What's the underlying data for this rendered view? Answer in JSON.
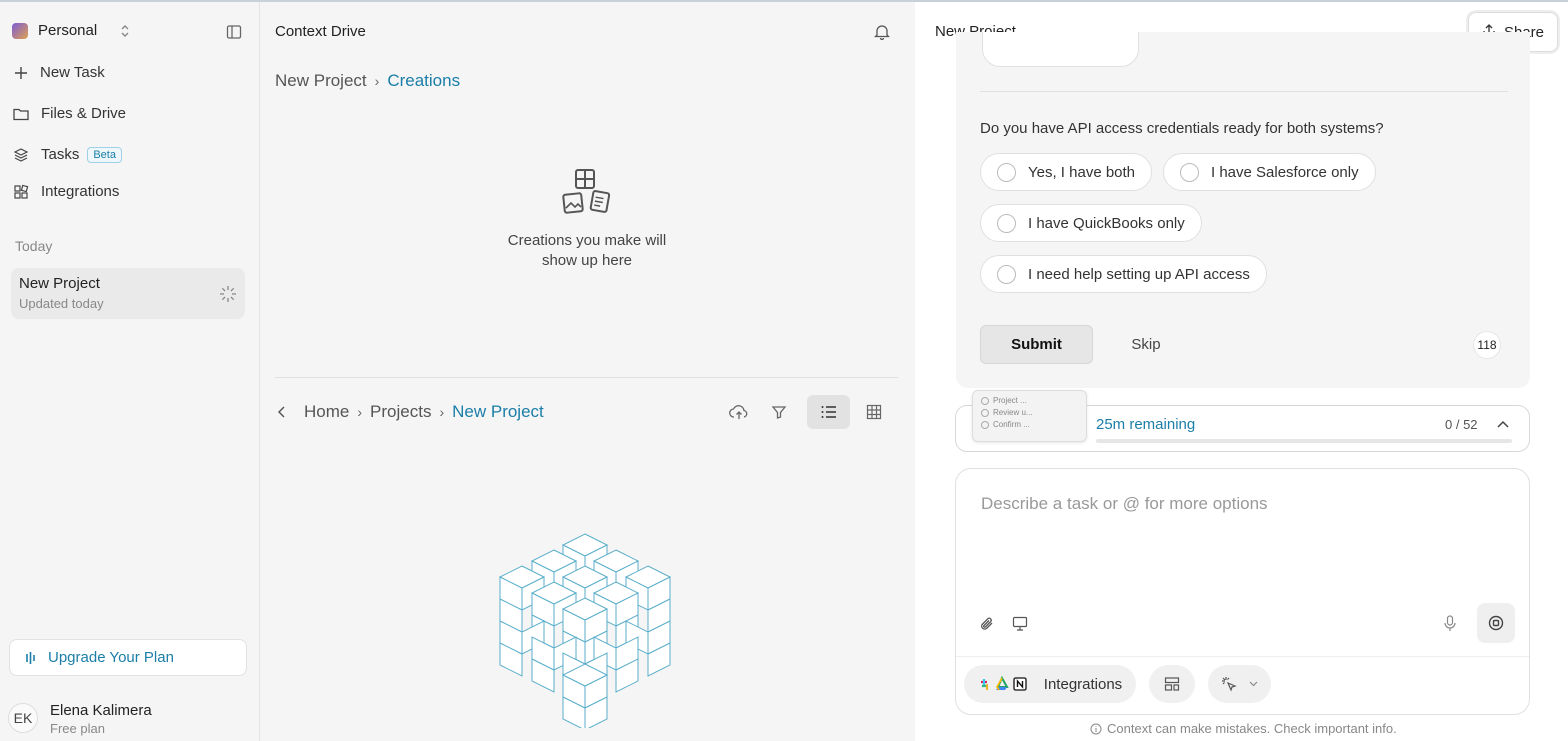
{
  "workspace": {
    "name": "Personal"
  },
  "nav": {
    "new_task": "New Task",
    "files": "Files & Drive",
    "tasks": "Tasks",
    "tasks_badge": "Beta",
    "integrations": "Integrations"
  },
  "history": {
    "section": "Today",
    "project_title": "New Project",
    "project_sub": "Updated today"
  },
  "upgrade": {
    "label": "Upgrade Your Plan"
  },
  "user": {
    "initials": "EK",
    "name": "Elena Kalimera",
    "plan": "Free plan"
  },
  "middle": {
    "title": "Context Drive",
    "top_crumbs": [
      "New Project",
      "Creations"
    ],
    "empty_text": "Creations you make will show up here",
    "bottom_crumbs": [
      "Home",
      "Projects",
      "New Project"
    ]
  },
  "right": {
    "title": "New Project",
    "share": "Share",
    "question": "Do you have API access credentials ready for both systems?",
    "options": [
      "Yes, I have both",
      "I have Salesforce only",
      "I have QuickBooks only",
      "I need help setting up API access"
    ],
    "submit": "Submit",
    "skip": "Skip",
    "char_count": "118",
    "progress": {
      "remaining": "25m remaining",
      "count": "0 / 52",
      "fraction": 0.0,
      "steps": [
        "Project ...",
        "Review u...",
        "Confirm ..."
      ]
    },
    "input_placeholder": "Describe a task or @ for more options",
    "integrations": "Integrations",
    "disclaimer": "Context can make mistakes. Check important info."
  },
  "colors": {
    "accent": "#1b7ea8"
  }
}
